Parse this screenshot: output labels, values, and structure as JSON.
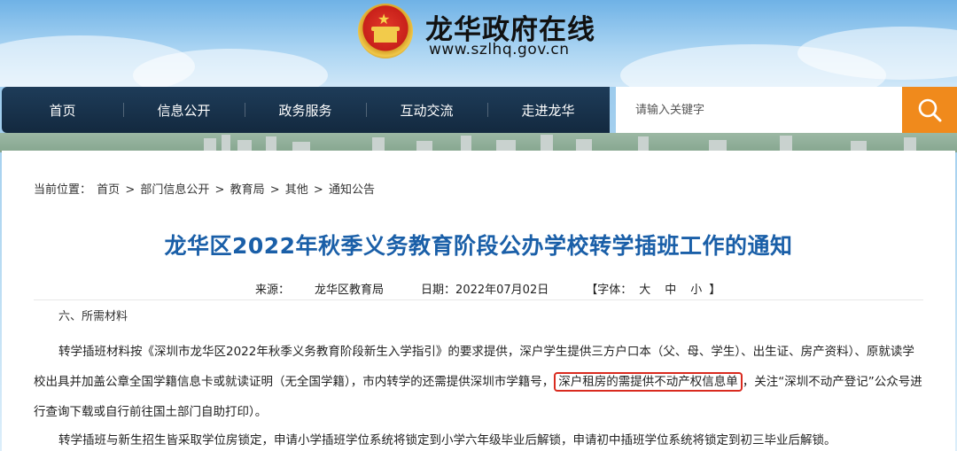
{
  "site": {
    "title": "龙华政府在线",
    "url": "www.szlhq.gov.cn"
  },
  "nav": {
    "items": [
      "首页",
      "信息公开",
      "政务服务",
      "互动交流",
      "走进龙华"
    ]
  },
  "search": {
    "placeholder": "请输入关键字"
  },
  "breadcrumb": {
    "label": "当前位置：",
    "items": [
      "首页",
      "部门信息公开",
      "教育局",
      "其他",
      "通知公告"
    ],
    "separator": ">"
  },
  "article": {
    "title": "龙华区2022年秋季义务教育阶段公办学校转学插班工作的通知",
    "source_label": "来源：",
    "source": "龙华区教育局",
    "date_label": "日期：",
    "date": "2022年07月02日",
    "font_label": "【字体：",
    "font_sizes": [
      "大",
      "中",
      "小"
    ],
    "font_close": "】",
    "section_head": "六、所需材料",
    "p1_before": "转学插班材料按《深圳市龙华区2022年秋季义务教育阶段新生入学指引》的要求提供，深户学生提供三方户口本（父、母、学生）、出生证、房产资料）、原就读学校出具并加盖公章全国学籍信息卡或就读证明（无全国学籍），市内转学的还需提供深圳市学籍号，",
    "p1_highlight": "深户租房的需提供不动产权信息单",
    "p1_after": "，关注“深圳不动产登记”公众号进行查询下载或自行前往国土部门自助打印）。",
    "p2": "转学插班与新生招生皆采取学位房锁定，申请小学插班学位系统将锁定到小学六年级毕业后解锁，申请初中插班学位系统将锁定到初三毕业后解锁。"
  },
  "colors": {
    "nav_bg": "#1a3550",
    "search_btn": "#f08a1c",
    "title_blue": "#1a5fa8",
    "highlight_red": "#d92b1f"
  },
  "icons": {
    "search": "search-icon",
    "emblem": "national-emblem-icon"
  }
}
